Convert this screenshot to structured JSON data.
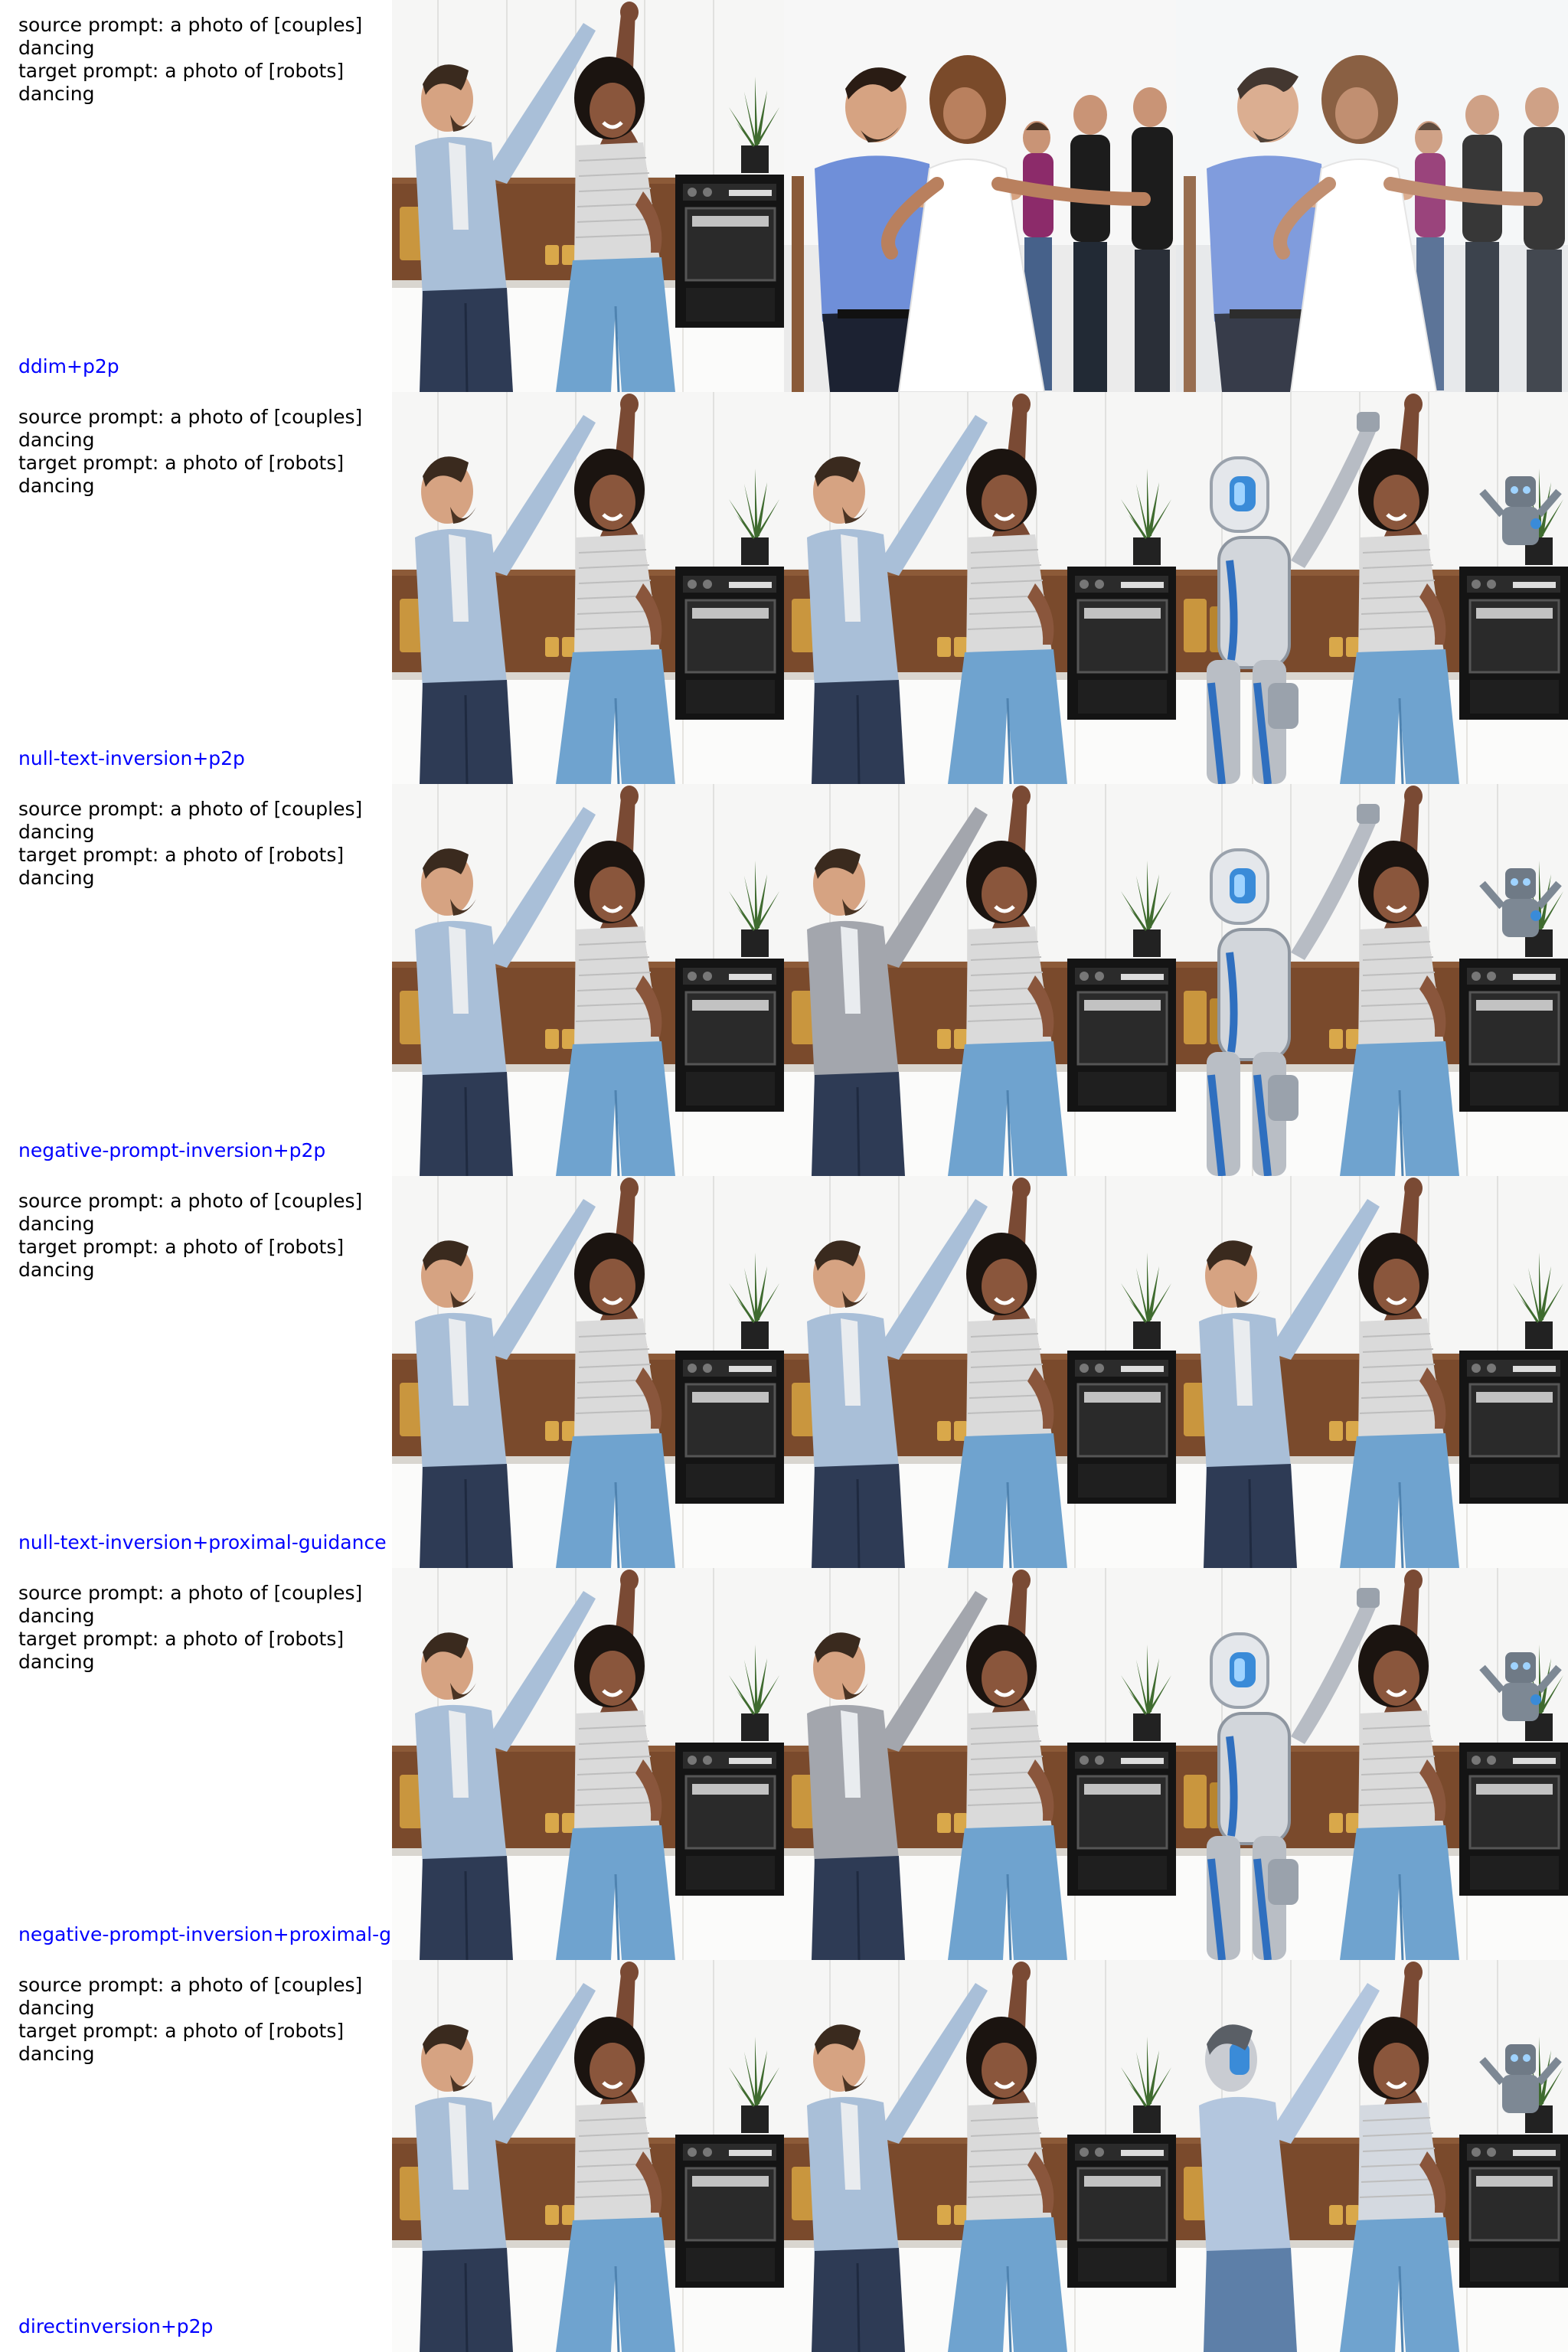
{
  "colors": {
    "method_label": "#0000ff",
    "prompt_text": "#000000"
  },
  "rows": [
    {
      "prompt": "source prompt: a photo of [couples]\ndancing\ntarget prompt: a photo of [robots]\ndancing",
      "method": "ddim+p2p"
    },
    {
      "prompt": "source prompt: a photo of [couples]\ndancing\ntarget prompt: a photo of [robots]\ndancing",
      "method": "null-text-inversion+p2p"
    },
    {
      "prompt": "source prompt: a photo of [couples]\ndancing\ntarget prompt: a photo of [robots]\ndancing",
      "method": "negative-prompt-inversion+p2p"
    },
    {
      "prompt": "source prompt: a photo of [couples]\ndancing\ntarget prompt: a photo of [robots]\ndancing",
      "method": "null-text-inversion+proximal-guidance"
    },
    {
      "prompt": "source prompt: a photo of [couples]\ndancing\ntarget prompt: a photo of [robots]\ndancing",
      "method": "negative-prompt-inversion+proximal-g"
    },
    {
      "prompt": "source prompt: a photo of [couples]\ndancing\ntarget prompt: a photo of [robots]\ndancing",
      "method": "directinversion+p2p"
    }
  ]
}
